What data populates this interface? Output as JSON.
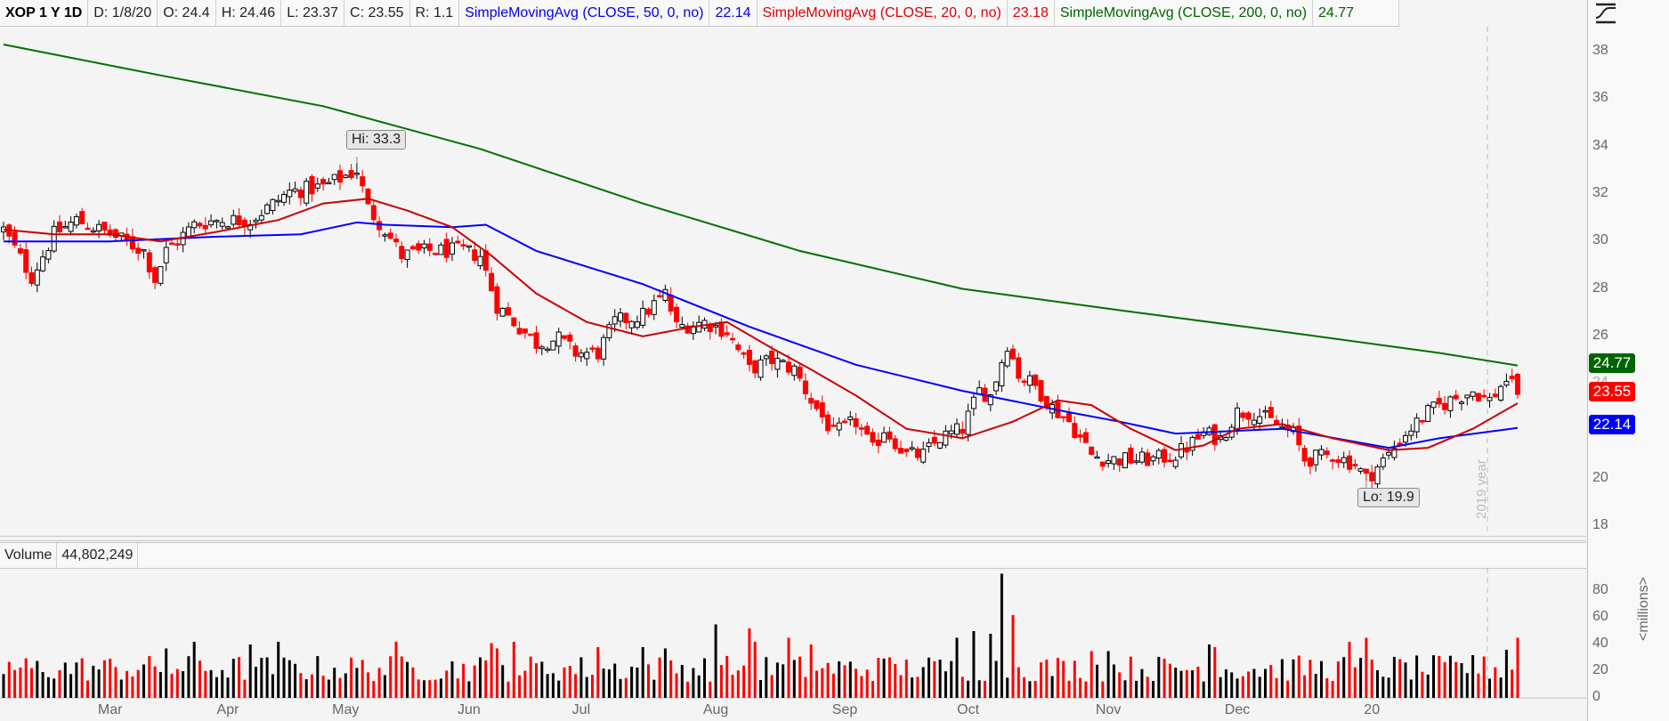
{
  "header": {
    "symbol": "XOP 1 Y 1D",
    "date": "D: 1/8/20",
    "open": "O: 24.4",
    "high": "H: 24.46",
    "low": "L: 23.37",
    "close": "C: 23.55",
    "range": "R: 1.1",
    "sma50_label": "SimpleMovingAvg (CLOSE, 50, 0, no)",
    "sma50_value": "22.14",
    "sma20_label": "SimpleMovingAvg (CLOSE, 20, 0, no)",
    "sma20_value": "23.18",
    "sma200_label": "SimpleMovingAvg (CLOSE, 200, 0, no)",
    "sma200_value": "24.77"
  },
  "icons": {
    "studies": "studies-icon"
  },
  "volume_header": {
    "label": "Volume",
    "value": "44,802,249"
  },
  "badges": {
    "sma200": "24.77",
    "last": "23.55",
    "sma50": "22.14"
  },
  "callouts": {
    "hi": "Hi: 33.3",
    "lo": "Lo: 19.9"
  },
  "year_marker": "2019 year",
  "volume_unit": "<millions>",
  "colors": {
    "up": "#000000",
    "down": "#ff0000",
    "sma50": "#0000ff",
    "sma20": "#cc0000",
    "sma200": "#007000"
  },
  "chart_data": [
    {
      "type": "candlestick",
      "title": "XOP 1 Y 1D",
      "x_unit": "trading day index",
      "ylim": [
        17.5,
        39
      ],
      "y_ticks": [
        "18",
        "20",
        "22",
        "24",
        "26",
        "28",
        "30",
        "32",
        "34",
        "36",
        "38"
      ],
      "x_tick_labels": [
        "Mar",
        "Apr",
        "May",
        "Jun",
        "Jul",
        "Aug",
        "Sep",
        "Oct",
        "Nov",
        "Dec",
        "20"
      ],
      "x_tick_index": [
        19,
        40,
        61,
        83,
        103,
        127,
        150,
        172,
        197,
        220,
        244
      ],
      "close_anchors": [
        [
          0,
          30.5
        ],
        [
          5,
          28.5
        ],
        [
          9,
          30.3
        ],
        [
          13,
          30.9
        ],
        [
          19,
          30.3
        ],
        [
          25,
          29.6
        ],
        [
          27,
          28.4
        ],
        [
          29,
          29.6
        ],
        [
          34,
          30.7
        ],
        [
          38,
          30.9
        ],
        [
          44,
          30.9
        ],
        [
          47,
          31.4
        ],
        [
          51,
          32.1
        ],
        [
          57,
          32.3
        ],
        [
          63,
          33
        ],
        [
          65,
          31.4
        ],
        [
          68,
          30.5
        ],
        [
          71,
          29.4
        ],
        [
          76,
          29.6
        ],
        [
          82,
          29.6
        ],
        [
          85,
          29.4
        ],
        [
          88,
          27.3
        ],
        [
          91,
          26.6
        ],
        [
          95,
          25.7
        ],
        [
          99,
          25.9
        ],
        [
          102,
          25.3
        ],
        [
          106,
          25.3
        ],
        [
          109,
          26.6
        ],
        [
          114,
          26.9
        ],
        [
          118,
          27.8
        ],
        [
          120,
          26.4
        ],
        [
          125,
          26.6
        ],
        [
          129,
          26.2
        ],
        [
          133,
          24.6
        ],
        [
          137,
          25
        ],
        [
          141,
          24.6
        ],
        [
          144,
          23.3
        ],
        [
          148,
          21.9
        ],
        [
          152,
          22.4
        ],
        [
          155,
          21.2
        ],
        [
          157,
          22.1
        ],
        [
          161,
          21
        ],
        [
          164,
          21
        ],
        [
          167,
          21.7
        ],
        [
          171,
          22.1
        ],
        [
          174,
          23.7
        ],
        [
          176,
          23.5
        ],
        [
          179,
          25.7
        ],
        [
          181,
          24.4
        ],
        [
          184,
          23.9
        ],
        [
          187,
          23
        ],
        [
          190,
          22.4
        ],
        [
          194,
          21
        ],
        [
          197,
          20.8
        ],
        [
          201,
          20.8
        ],
        [
          205,
          20.8
        ],
        [
          209,
          21
        ],
        [
          212,
          21.5
        ],
        [
          214,
          21.9
        ],
        [
          217,
          21.7
        ],
        [
          220,
          22.8
        ],
        [
          223,
          22.8
        ],
        [
          226,
          22.4
        ],
        [
          230,
          21.9
        ],
        [
          232,
          20.8
        ],
        [
          237,
          21
        ],
        [
          241,
          20.6
        ],
        [
          243,
          20
        ],
        [
          247,
          21
        ],
        [
          250,
          21.9
        ],
        [
          254,
          22.8
        ],
        [
          258,
          23.3
        ],
        [
          262,
          23.7
        ],
        [
          265,
          23.3
        ],
        [
          268,
          24.2
        ],
        [
          270,
          23.55
        ]
      ],
      "last_bar": {
        "open": 24.4,
        "high": 24.46,
        "low": 23.37,
        "close": 23.55
      },
      "annotations": [
        {
          "text": "Hi: 33.3",
          "index": 63,
          "value": 33.3
        },
        {
          "text": "Lo: 19.9",
          "index": 243,
          "value": 19.9
        }
      ],
      "series": [
        {
          "name": "SimpleMovingAvg (CLOSE, 200, 0, no)",
          "color": "#007000",
          "points": [
            [
              0,
              38.3
            ],
            [
              28,
              37
            ],
            [
              57,
              35.7
            ],
            [
              85,
              33.9
            ],
            [
              114,
              31.6
            ],
            [
              142,
              29.6
            ],
            [
              171,
              28
            ],
            [
              199,
              27.1
            ],
            [
              228,
              26.2
            ],
            [
              256,
              25.3
            ],
            [
              270,
              24.77
            ]
          ]
        },
        {
          "name": "SimpleMovingAvg (CLOSE, 50, 0, no)",
          "color": "#0000ff",
          "points": [
            [
              0,
              30
            ],
            [
              19,
              30
            ],
            [
              38,
              30.2
            ],
            [
              53,
              30.3
            ],
            [
              63,
              30.8
            ],
            [
              68,
              30.7
            ],
            [
              80,
              30.6
            ],
            [
              86,
              30.7
            ],
            [
              95,
              29.6
            ],
            [
              114,
              28.2
            ],
            [
              133,
              26.4
            ],
            [
              152,
              24.8
            ],
            [
              171,
              23.7
            ],
            [
              190,
              22.8
            ],
            [
              199,
              22.4
            ],
            [
              209,
              21.9
            ],
            [
              228,
              22.1
            ],
            [
              247,
              21.3
            ],
            [
              256,
              21.7
            ],
            [
              270,
              22.14
            ]
          ]
        },
        {
          "name": "SimpleMovingAvg (CLOSE, 20, 0, no)",
          "color": "#cc0000",
          "points": [
            [
              0,
              30.5
            ],
            [
              9,
              30.3
            ],
            [
              19,
              30.3
            ],
            [
              28,
              30
            ],
            [
              38,
              30.4
            ],
            [
              49,
              30.9
            ],
            [
              57,
              31.6
            ],
            [
              65,
              31.8
            ],
            [
              72,
              31.3
            ],
            [
              80,
              30.6
            ],
            [
              87,
              29.4
            ],
            [
              95,
              27.8
            ],
            [
              104,
              26.6
            ],
            [
              114,
              26
            ],
            [
              123,
              26.4
            ],
            [
              129,
              26.6
            ],
            [
              137,
              25.5
            ],
            [
              144,
              24.6
            ],
            [
              152,
              23.5
            ],
            [
              161,
              22.1
            ],
            [
              171,
              21.7
            ],
            [
              180,
              22.4
            ],
            [
              188,
              23.3
            ],
            [
              194,
              23.1
            ],
            [
              201,
              22.1
            ],
            [
              209,
              21.2
            ],
            [
              214,
              21.4
            ],
            [
              220,
              22.1
            ],
            [
              228,
              22.3
            ],
            [
              237,
              21.7
            ],
            [
              247,
              21.2
            ],
            [
              254,
              21.3
            ],
            [
              262,
              22.1
            ],
            [
              270,
              23.18
            ]
          ]
        }
      ]
    },
    {
      "type": "bar",
      "title": "Volume",
      "ylabel": "<millions>",
      "ylim": [
        0,
        95
      ],
      "y_ticks": [
        "0",
        "20",
        "40",
        "60",
        "80"
      ],
      "base_range_millions": [
        12,
        32
      ],
      "spikes": [
        [
          29,
          37
        ],
        [
          34,
          42
        ],
        [
          44,
          40
        ],
        [
          49,
          42
        ],
        [
          70,
          42
        ],
        [
          87,
          41
        ],
        [
          88,
          37
        ],
        [
          91,
          42
        ],
        [
          106,
          38
        ],
        [
          114,
          38
        ],
        [
          118,
          37
        ],
        [
          127,
          55
        ],
        [
          133,
          52
        ],
        [
          134,
          42
        ],
        [
          140,
          45
        ],
        [
          144,
          40
        ],
        [
          156,
          30
        ],
        [
          170,
          45
        ],
        [
          173,
          50
        ],
        [
          176,
          48
        ],
        [
          178,
          93
        ],
        [
          180,
          62
        ],
        [
          194,
          35
        ],
        [
          197,
          35
        ],
        [
          215,
          40
        ],
        [
          216,
          38
        ],
        [
          240,
          42
        ],
        [
          243,
          45
        ],
        [
          262,
          32
        ],
        [
          268,
          36
        ],
        [
          270,
          45
        ]
      ],
      "last_value": 44.8
    }
  ]
}
